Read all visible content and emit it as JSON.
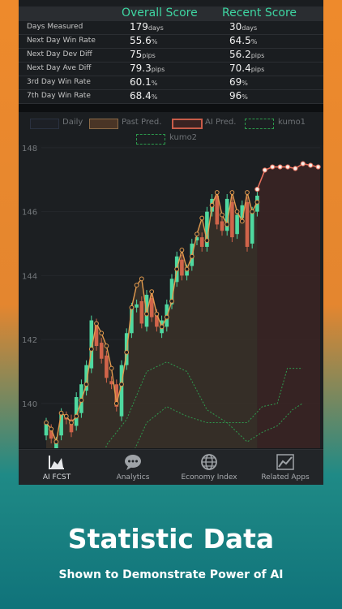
{
  "score_table": {
    "col_overall": "Overall Score",
    "col_recent": "Recent Score",
    "rows": [
      {
        "label": "Days Measured",
        "overall": "179",
        "overall_unit": "days",
        "recent": "30",
        "recent_unit": "days"
      },
      {
        "label": "Next Day Win Rate",
        "overall": "55.6",
        "overall_unit": "%",
        "recent": "64.5",
        "recent_unit": "%"
      },
      {
        "label": "Next Day Dev Diff",
        "overall": "75",
        "overall_unit": "pips",
        "recent": "56.2",
        "recent_unit": "pips"
      },
      {
        "label": "Next Day Ave Diff",
        "overall": "79.3",
        "overall_unit": "pips",
        "recent": "70.4",
        "recent_unit": "pips"
      },
      {
        "label": "3rd Day Win Rate",
        "overall": "60.1",
        "overall_unit": "%",
        "recent": "69",
        "recent_unit": "%"
      },
      {
        "label": "7th Day Win Rate",
        "overall": "68.4",
        "overall_unit": "%",
        "recent": "96",
        "recent_unit": "%"
      }
    ]
  },
  "legend": {
    "daily": "Daily",
    "past": "Past Pred.",
    "ai": "AI Pred.",
    "kumo1": "kumo1",
    "kumo2": "kumo2"
  },
  "colors": {
    "up": "#4fd9a0",
    "down": "#d0644a",
    "pred": "#e29a4e",
    "ai": "#e8705c",
    "kumo": "#2f9a4e",
    "accent": "#3ed6a2"
  },
  "chart_data": {
    "type": "candlestick",
    "ylim": [
      138.6,
      148.1
    ],
    "yticks": [
      "148",
      "146",
      "144",
      "142",
      "140"
    ],
    "ytick_values": [
      148,
      146,
      144,
      142,
      140
    ],
    "candles": [
      [
        139.0,
        139.4
      ],
      [
        139.2,
        138.9
      ],
      [
        138.6,
        138.8
      ],
      [
        139.0,
        139.7
      ],
      [
        139.6,
        139.5
      ],
      [
        139.5,
        139.1
      ],
      [
        139.3,
        140.2
      ],
      [
        139.7,
        140.6
      ],
      [
        140.4,
        141.2
      ],
      [
        141.1,
        142.6
      ],
      [
        142.5,
        141.8
      ],
      [
        141.9,
        141.4
      ],
      [
        141.5,
        140.8
      ],
      [
        140.7,
        140.6
      ],
      [
        140.6,
        139.9
      ],
      [
        139.6,
        141.2
      ],
      [
        141.2,
        142.2
      ],
      [
        142.2,
        143.0
      ],
      [
        143.0,
        143.1
      ],
      [
        143.2,
        142.5
      ],
      [
        142.4,
        143.4
      ],
      [
        143.3,
        142.7
      ],
      [
        142.8,
        142.4
      ],
      [
        142.2,
        142.6
      ],
      [
        142.4,
        143.1
      ],
      [
        143.1,
        143.9
      ],
      [
        143.8,
        144.6
      ],
      [
        144.5,
        144.0
      ],
      [
        144.0,
        144.2
      ],
      [
        144.3,
        145.0
      ],
      [
        145.1,
        145.2
      ],
      [
        145.2,
        144.9
      ],
      [
        144.9,
        146.0
      ],
      [
        146.0,
        146.4
      ],
      [
        146.5,
        145.6
      ],
      [
        145.7,
        145.4
      ],
      [
        145.4,
        146.4
      ],
      [
        146.3,
        145.2
      ],
      [
        145.3,
        145.9
      ],
      [
        145.8,
        146.2
      ],
      [
        146.3,
        144.9
      ],
      [
        145.0,
        146.0
      ],
      [
        146.0,
        146.5
      ]
    ],
    "past_pred": [
      139.4,
      139.2,
      138.8,
      139.7,
      139.6,
      139.4,
      139.6,
      140.1,
      140.6,
      141.7,
      142.5,
      142.2,
      141.8,
      141.1,
      140.0,
      140.6,
      141.6,
      143.0,
      143.7,
      143.9,
      142.8,
      143.5,
      142.8,
      142.4,
      142.7,
      143.2,
      144.2,
      144.8,
      144.2,
      144.6,
      145.3,
      145.8,
      145.1,
      146.2,
      146.6,
      145.9,
      145.6,
      146.6,
      146.0,
      145.7,
      146.6,
      146.0,
      146.3
    ],
    "ai_pred": [
      146.7,
      147.3,
      147.4,
      147.4,
      147.4,
      147.35,
      147.5,
      147.45,
      147.4
    ],
    "kumo1": [
      [
        0,
        134.0
      ],
      [
        4,
        134.2
      ],
      [
        8,
        135.6
      ],
      [
        12,
        138.7
      ],
      [
        16,
        139.5
      ],
      [
        20,
        141.0
      ],
      [
        24,
        141.3
      ],
      [
        28,
        141.0
      ],
      [
        32,
        139.8
      ],
      [
        36,
        139.4
      ],
      [
        40,
        138.8
      ],
      [
        43,
        139.1
      ],
      [
        46,
        139.3
      ],
      [
        49,
        139.8
      ],
      [
        51,
        140.0
      ]
    ],
    "kumo2": [
      [
        0,
        134.2
      ],
      [
        6,
        134.0
      ],
      [
        12,
        134.8
      ],
      [
        16,
        138.0
      ],
      [
        20,
        139.4
      ],
      [
        24,
        139.9
      ],
      [
        28,
        139.6
      ],
      [
        32,
        139.4
      ],
      [
        36,
        139.4
      ],
      [
        40,
        139.4
      ],
      [
        43,
        139.9
      ],
      [
        46,
        140.0
      ],
      [
        48,
        141.1
      ],
      [
        51,
        141.1
      ]
    ]
  },
  "tabs": [
    {
      "label": "AI FCST",
      "icon": "area-chart-icon"
    },
    {
      "label": "Analytics",
      "icon": "chat-bubble-icon"
    },
    {
      "label": "Economy Index",
      "icon": "globe-icon"
    },
    {
      "label": "Related Apps",
      "icon": "line-chart-icon"
    }
  ],
  "promo": {
    "title": "Statistic Data",
    "subtitle": "Shown to Demonstrate Power of AI"
  }
}
